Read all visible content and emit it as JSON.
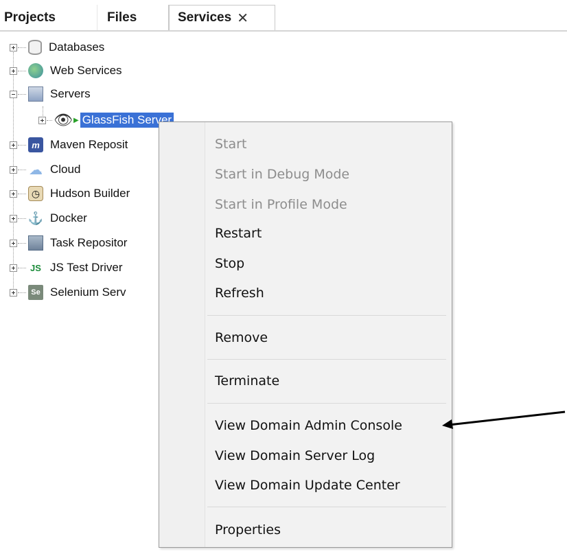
{
  "tabs": [
    {
      "label": "Projects"
    },
    {
      "label": "Files"
    },
    {
      "label": "Services",
      "close": "✕"
    }
  ],
  "tree": {
    "items": [
      {
        "label": "Databases",
        "icon": "database-icon"
      },
      {
        "label": "Web Services",
        "icon": "web-services-icon"
      },
      {
        "label": "Servers",
        "icon": "servers-icon"
      },
      {
        "label": "GlassFish Server",
        "icon": "glassfish-icon"
      },
      {
        "label": "Maven Reposit",
        "icon": "maven-icon"
      },
      {
        "label": "Cloud",
        "icon": "cloud-icon"
      },
      {
        "label": "Hudson Builder",
        "icon": "hudson-icon"
      },
      {
        "label": "Docker",
        "icon": "docker-icon"
      },
      {
        "label": "Task Repositor",
        "icon": "task-repository-icon"
      },
      {
        "label": "JS Test Driver",
        "icon": "js-test-driver-icon"
      },
      {
        "label": "Selenium Serv",
        "icon": "selenium-icon"
      }
    ]
  },
  "menu": {
    "items": [
      {
        "label": "Start",
        "disabled": true
      },
      {
        "label": "Start in Debug Mode",
        "disabled": true
      },
      {
        "label": "Start in Profile Mode",
        "disabled": true
      },
      {
        "label": "Restart"
      },
      {
        "label": "Stop"
      },
      {
        "label": "Refresh"
      },
      {
        "label": "Remove"
      },
      {
        "label": "Terminate"
      },
      {
        "label": "View Domain Admin Console"
      },
      {
        "label": "View Domain Server Log"
      },
      {
        "label": "View Domain Update Center"
      },
      {
        "label": "Properties"
      }
    ]
  },
  "colors": {
    "selection": "#3a71d6",
    "disabled_text": "#8d8d8d",
    "menu_background": "#f2f2f2"
  }
}
